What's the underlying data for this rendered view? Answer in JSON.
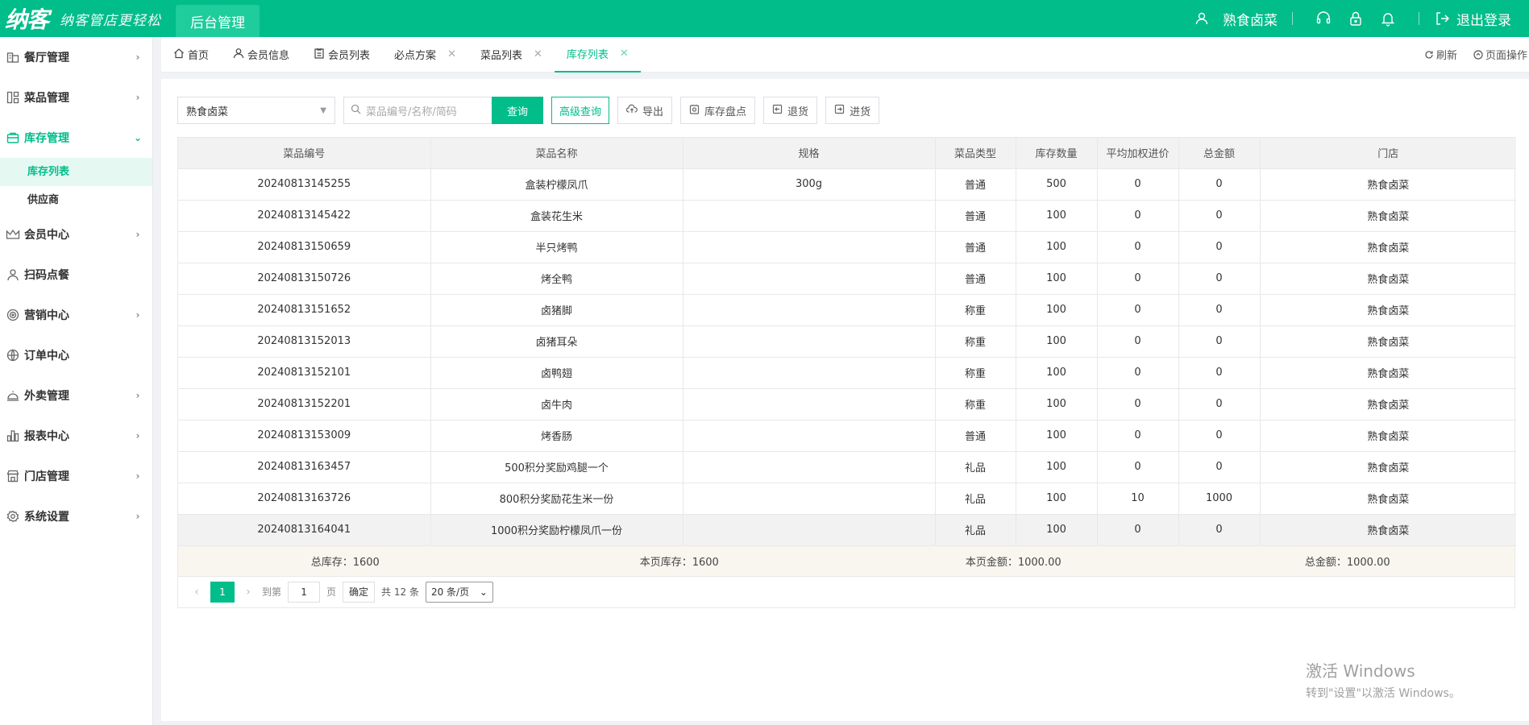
{
  "header": {
    "logo": "纳客",
    "slogan": "纳客管店更轻松",
    "admin_tab": "后台管理",
    "user_name": "熟食卤菜",
    "logout": "退出登录"
  },
  "sidebar": {
    "items": [
      {
        "label": "餐厅管理",
        "icon": "store-icon",
        "chevron": "›"
      },
      {
        "label": "菜品管理",
        "icon": "dish-icon",
        "chevron": "›"
      },
      {
        "label": "库存管理",
        "icon": "inventory-icon",
        "chevron": "⌄",
        "active": true
      },
      {
        "label": "会员中心",
        "icon": "crown-icon",
        "chevron": "›"
      },
      {
        "label": "扫码点餐",
        "icon": "user-icon",
        "chevron": ""
      },
      {
        "label": "营销中心",
        "icon": "target-icon",
        "chevron": "›"
      },
      {
        "label": "订单中心",
        "icon": "globe-icon",
        "chevron": ""
      },
      {
        "label": "外卖管理",
        "icon": "bell-dish-icon",
        "chevron": "›"
      },
      {
        "label": "报表中心",
        "icon": "chart-icon",
        "chevron": "›"
      },
      {
        "label": "门店管理",
        "icon": "shop-icon",
        "chevron": "›"
      },
      {
        "label": "系统设置",
        "icon": "gear-icon",
        "chevron": "›"
      }
    ],
    "subitems": [
      {
        "label": "库存列表",
        "active": true
      },
      {
        "label": "供应商"
      }
    ]
  },
  "tabs": [
    {
      "label": "首页",
      "closable": false,
      "icon": "home-icon"
    },
    {
      "label": "会员信息",
      "closable": false,
      "icon": "user-icon"
    },
    {
      "label": "会员列表",
      "closable": false,
      "icon": "clipboard-icon"
    },
    {
      "label": "必点方案",
      "closable": true
    },
    {
      "label": "菜品列表",
      "closable": true
    },
    {
      "label": "库存列表",
      "closable": true,
      "active": true
    }
  ],
  "tabs_right": {
    "refresh": "刷新",
    "page_ops": "页面操作"
  },
  "toolbar": {
    "store_select": "熟食卤菜",
    "search_placeholder": "菜品编号/名称/简码",
    "query": "查询",
    "advanced": "高级查询",
    "export": "导出",
    "stocktake": "库存盘点",
    "return": "退货",
    "purchase": "进货"
  },
  "table": {
    "columns": [
      "菜品编号",
      "菜品名称",
      "规格",
      "菜品类型",
      "库存数量",
      "平均加权进价",
      "总金额",
      "门店"
    ],
    "rows": [
      [
        "20240813145255",
        "盒装柠檬凤爪",
        "300g",
        "普通",
        "500",
        "0",
        "0",
        "熟食卤菜"
      ],
      [
        "20240813145422",
        "盒装花生米",
        "",
        "普通",
        "100",
        "0",
        "0",
        "熟食卤菜"
      ],
      [
        "20240813150659",
        "半只烤鸭",
        "",
        "普通",
        "100",
        "0",
        "0",
        "熟食卤菜"
      ],
      [
        "20240813150726",
        "烤全鸭",
        "",
        "普通",
        "100",
        "0",
        "0",
        "熟食卤菜"
      ],
      [
        "20240813151652",
        "卤猪脚",
        "",
        "称重",
        "100",
        "0",
        "0",
        "熟食卤菜"
      ],
      [
        "20240813152013",
        "卤猪耳朵",
        "",
        "称重",
        "100",
        "0",
        "0",
        "熟食卤菜"
      ],
      [
        "20240813152101",
        "卤鸭翅",
        "",
        "称重",
        "100",
        "0",
        "0",
        "熟食卤菜"
      ],
      [
        "20240813152201",
        "卤牛肉",
        "",
        "称重",
        "100",
        "0",
        "0",
        "熟食卤菜"
      ],
      [
        "20240813153009",
        "烤香肠",
        "",
        "普通",
        "100",
        "0",
        "0",
        "熟食卤菜"
      ],
      [
        "20240813163457",
        "500积分奖励鸡腿一个",
        "",
        "礼品",
        "100",
        "0",
        "0",
        "熟食卤菜"
      ],
      [
        "20240813163726",
        "800积分奖励花生米一份",
        "",
        "礼品",
        "100",
        "10",
        "1000",
        "熟食卤菜"
      ],
      [
        "20240813164041",
        "1000积分奖励柠檬凤爪一份",
        "",
        "礼品",
        "100",
        "0",
        "0",
        "熟食卤菜"
      ]
    ]
  },
  "summary": {
    "total_stock": "总库存：1600",
    "page_stock": "本页库存：1600",
    "page_amount": "本页金额：1000.00",
    "total_amount": "总金额：1000.00"
  },
  "pager": {
    "current": "1",
    "goto_label": "到第",
    "goto_value": "1",
    "page_unit": "页",
    "confirm": "确定",
    "total": "共 12 条",
    "page_size": "20 条/页"
  },
  "watermark": {
    "line1": "激活 Windows",
    "line2": "转到\"设置\"以激活 Windows。"
  },
  "colors": {
    "accent": "#00bd8a"
  }
}
